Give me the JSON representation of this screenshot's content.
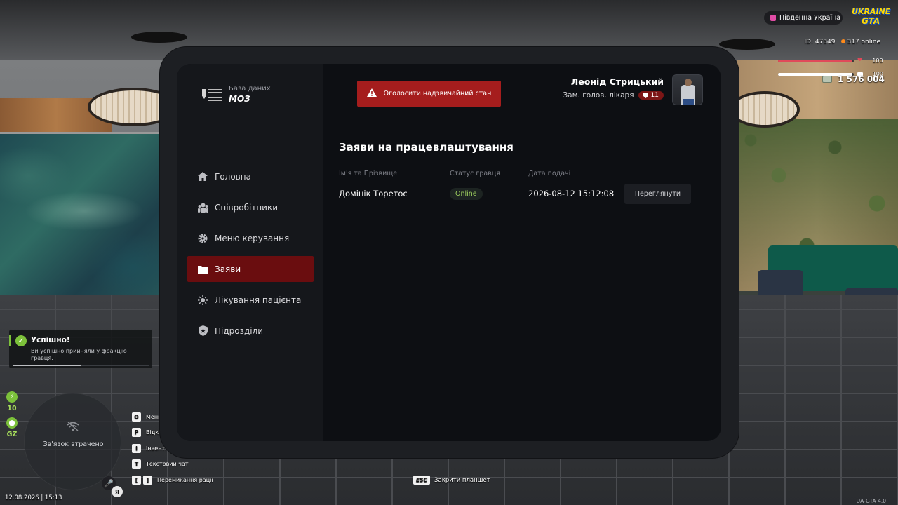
{
  "hud": {
    "region": "Південна Україна",
    "game_logo_line1": "UKRAINE",
    "game_logo_line2": "GTA",
    "player_id": "ID: 47349",
    "online": "317 online",
    "health": "100",
    "armor": "100",
    "money": "1 576 004",
    "datetime": "12.08.2026 | 15:13",
    "version": "UA-GTA 4.0",
    "side_stat_1": "10",
    "side_stat_2": "GZ",
    "minimap_status": "Зв'язок втрачено",
    "mic_user": "Я",
    "colors": {
      "health": "#e04a5a",
      "armor": "#ffffff",
      "accent_green": "#7cc13a"
    },
    "health_fraction": 0.98,
    "armor_fraction": 0.98
  },
  "toast": {
    "title": "Успішно!",
    "message": "Ви успішно прийняли у фракцію гравця.",
    "progress_fraction": 0.5
  },
  "hotkeys": [
    {
      "key": "O",
      "label": "Мені"
    },
    {
      "key": "P",
      "label": "Відк"
    },
    {
      "key": "I",
      "label": "Інвент."
    },
    {
      "key": "T",
      "label": "Текстовий чат"
    },
    {
      "key": "[",
      "key2": "]",
      "label": "Перемикання рації"
    }
  ],
  "esc_hint": {
    "key": "ESC",
    "label": "Закрити планшет"
  },
  "tablet": {
    "logo": {
      "subtitle": "База даних",
      "title": "МОЗ"
    },
    "emergency_button": "Оголосити надзвичайний стан",
    "user": {
      "name": "Леонід Стрицький",
      "role": "Зам. голов. лікаря",
      "rank": "11"
    },
    "nav": [
      {
        "label": "Головна",
        "icon": "home-icon",
        "active": false
      },
      {
        "label": "Співробітники",
        "icon": "users-icon",
        "active": false
      },
      {
        "label": "Меню керування",
        "icon": "gear-icon",
        "active": false
      },
      {
        "label": "Заяви",
        "icon": "folder-icon",
        "active": true
      },
      {
        "label": "Лікування пацієнта",
        "icon": "sun-icon",
        "active": false
      },
      {
        "label": "Підрозділи",
        "icon": "shield-icon",
        "active": false
      }
    ],
    "page_title": "Заяви на працевлаштування",
    "table": {
      "headers": [
        "Ім'я та Прізвище",
        "Статус гравця",
        "Дата подачі",
        ""
      ],
      "rows": [
        {
          "name": "Домінік Торетос",
          "status": "Online",
          "date": "2026-08-12 15:12:08",
          "action": "Переглянути"
        }
      ]
    },
    "accent_color": "#6a0d0f",
    "emergency_color": "#a51d1d"
  }
}
